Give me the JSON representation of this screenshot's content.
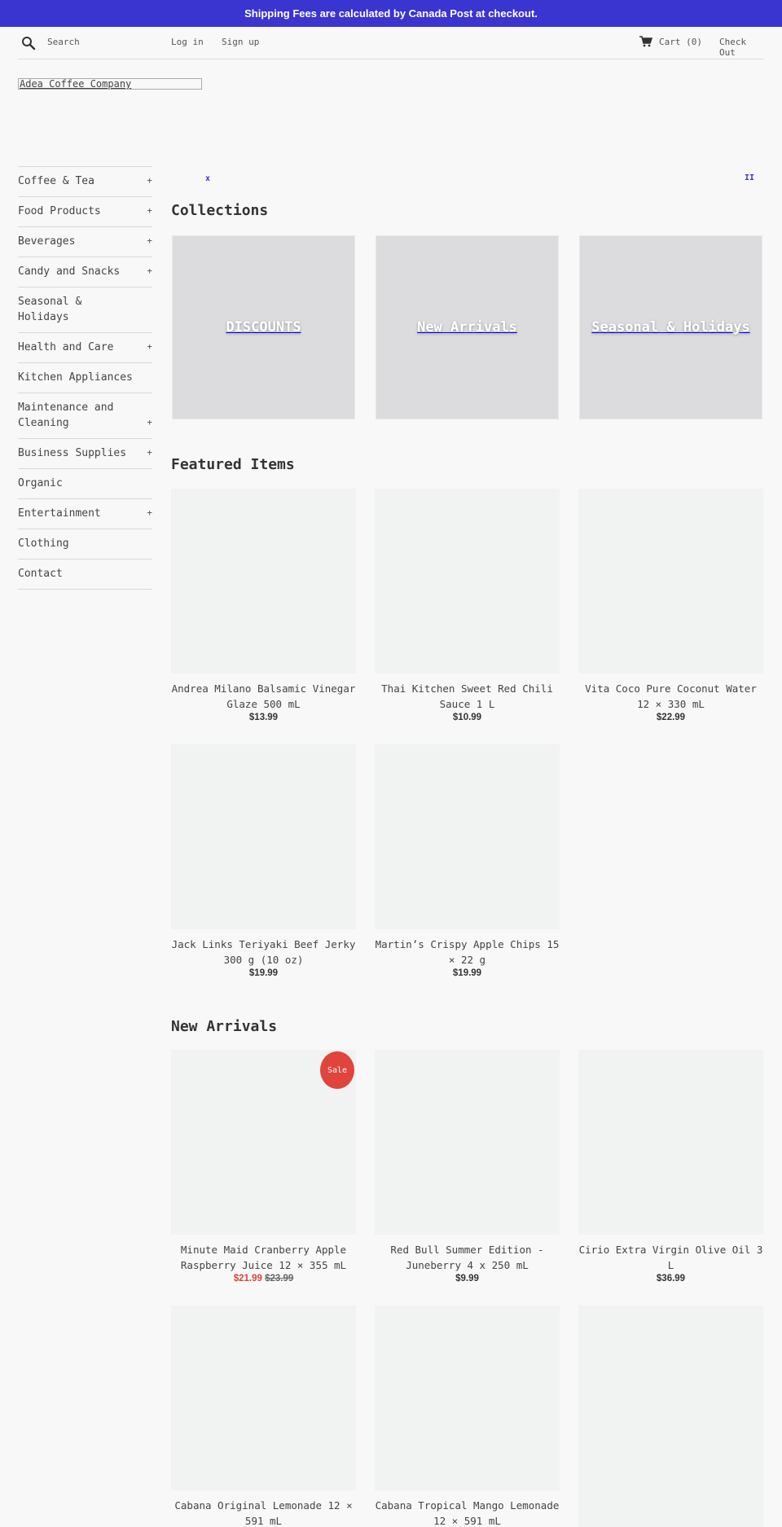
{
  "announcement": "Shipping Fees are calculated by Canada Post at checkout.",
  "header": {
    "search_placeholder": "Search",
    "login_label": "Log in",
    "signup_label": "Sign up",
    "cart_label": "Cart (0)",
    "checkout_label": "Check Out"
  },
  "logo_text": "Adea Coffee Company",
  "sidebar": {
    "items": [
      {
        "label": "Coffee & Tea",
        "expand": "+"
      },
      {
        "label": "Food Products",
        "expand": "+"
      },
      {
        "label": "Beverages",
        "expand": "+"
      },
      {
        "label": "Candy and Snacks",
        "expand": "+"
      },
      {
        "label": "Seasonal & Holidays",
        "expand": ""
      },
      {
        "label": "Health and Care",
        "expand": "+"
      },
      {
        "label": "Kitchen Appliances",
        "expand": ""
      },
      {
        "label": "Maintenance and Cleaning",
        "expand": "+"
      },
      {
        "label": "Business Supplies",
        "expand": "+"
      },
      {
        "label": "Organic",
        "expand": ""
      },
      {
        "label": "Entertainment",
        "expand": "+"
      },
      {
        "label": "Clothing",
        "expand": ""
      },
      {
        "label": "Contact",
        "expand": ""
      }
    ]
  },
  "slider": {
    "prev_symbol": "x",
    "pause_symbol": "II"
  },
  "collections": {
    "title": "Collections",
    "cards": [
      {
        "label": "DISCOUNTS"
      },
      {
        "label": "New Arrivals"
      },
      {
        "label": "Seasonal & Holidays"
      }
    ]
  },
  "featured": {
    "title": "Featured Items",
    "products": [
      {
        "name": "Andrea Milano Balsamic Vinegar Glaze 500 mL",
        "price": "$13.99"
      },
      {
        "name": "Thai Kitchen Sweet Red Chili Sauce 1 L",
        "price": "$10.99"
      },
      {
        "name": "Vita Coco Pure Coconut Water 12 × 330 mL",
        "price": "$22.99"
      },
      {
        "name": "Jack Links Teriyaki Beef Jerky 300 g (10 oz)",
        "price": "$19.99"
      },
      {
        "name": "Martin’s Crispy Apple Chips 15 × 22 g",
        "price": "$19.99"
      }
    ]
  },
  "new_arrivals": {
    "title": "New Arrivals",
    "products": [
      {
        "name": "Minute Maid Cranberry Apple Raspberry Juice 12 × 355 mL",
        "sale_price": "$21.99",
        "original_price": "$23.99",
        "badge": "Sale"
      },
      {
        "name": "Red Bull Summer Edition - Juneberry 4 x 250 mL",
        "price": "$9.99"
      },
      {
        "name": "Cirio Extra Virgin Olive Oil 3 L",
        "price": "$36.99"
      },
      {
        "name": "Cabana Original Lemonade 12 × 591 mL"
      },
      {
        "name": "Cabana Tropical Mango Lemonade 12 × 591 mL"
      }
    ]
  }
}
